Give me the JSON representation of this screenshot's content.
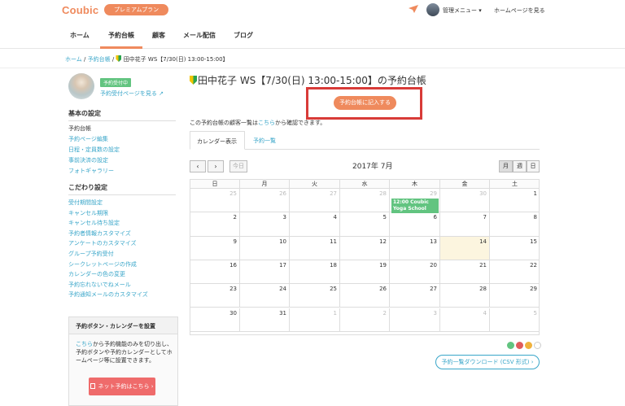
{
  "header": {
    "logo": "Coubic",
    "plan_badge": "プレミアムプラン",
    "admin_menu": "管理メニュー ▾",
    "home_link": "ホームページを見る"
  },
  "nav": {
    "items": [
      "ホーム",
      "予約台帳",
      "顧客",
      "メール配信",
      "ブログ"
    ],
    "active": "予約台帳"
  },
  "breadcrumb": {
    "home": "ホーム",
    "sep": "/",
    "ledger": "予約台帳",
    "current": "田中花子 WS【7/30(日) 13:00-15:00】"
  },
  "sidebar": {
    "status_badge": "予約受付中",
    "reservation_page_link": "予約受付ページを見る ↗",
    "basic_heading": "基本の設定",
    "basic_items": [
      "予約台帳",
      "予約ページ編集",
      "日程・定員数の設定",
      "事前決済の設定",
      "フォトギャラリー"
    ],
    "advanced_heading": "こだわり設定",
    "advanced_items": [
      "受付期間設定",
      "キャンセル期限",
      "キャンセル待ち設定",
      "予約者情報カスタマイズ",
      "アンケートのカスタマイズ",
      "グループ予約受付",
      "シークレットページの作成",
      "カレンダーの色の変更",
      "予約忘れないでねメール",
      "予約通知メールのカスタマイズ"
    ],
    "box_heading": "予約ボタン・カレンダーを設置",
    "box_text_link": "こちら",
    "box_text": "から予約機能のみを切り出し、予約ボタンや予約カレンダーとしてホームページ等に設置できます。",
    "net_button": "ネット予約はこちら ›"
  },
  "main": {
    "title": "田中花子 WS【7/30(日) 13:00-15:00】の予約台帳",
    "fill_button": "予約台帳に記入する",
    "info_prefix": "この予約台帳の顧客一覧は",
    "info_link": "こちら",
    "info_suffix": "から確認できます。",
    "tabs": [
      "カレンダー表示",
      "予約一覧"
    ],
    "prev": "‹",
    "next": "›",
    "today": "今日",
    "month": "2017年 7月",
    "views": [
      "月",
      "週",
      "日"
    ],
    "download_button": "予約一覧ダウンロード (CSV 形式) ›"
  },
  "calendar": {
    "weekdays": [
      "日",
      "月",
      "火",
      "水",
      "木",
      "金",
      "土"
    ],
    "weeks": [
      [
        {
          "d": "25",
          "o": true
        },
        {
          "d": "26",
          "o": true
        },
        {
          "d": "27",
          "o": true
        },
        {
          "d": "28",
          "o": true
        },
        {
          "d": "29",
          "o": true
        },
        {
          "d": "30",
          "o": true
        },
        {
          "d": "1",
          "o": false
        }
      ],
      [
        {
          "d": "2",
          "o": false
        },
        {
          "d": "3",
          "o": false
        },
        {
          "d": "4",
          "o": false
        },
        {
          "d": "5",
          "o": false
        },
        {
          "d": "6",
          "o": false
        },
        {
          "d": "7",
          "o": false
        },
        {
          "d": "8",
          "o": false
        }
      ],
      [
        {
          "d": "9",
          "o": false
        },
        {
          "d": "10",
          "o": false
        },
        {
          "d": "11",
          "o": false
        },
        {
          "d": "12",
          "o": false
        },
        {
          "d": "13",
          "o": false
        },
        {
          "d": "14",
          "o": false
        },
        {
          "d": "15",
          "o": false
        }
      ],
      [
        {
          "d": "16",
          "o": false
        },
        {
          "d": "17",
          "o": false
        },
        {
          "d": "18",
          "o": false
        },
        {
          "d": "19",
          "o": false
        },
        {
          "d": "20",
          "o": false
        },
        {
          "d": "21",
          "o": false
        },
        {
          "d": "22",
          "o": false
        }
      ],
      [
        {
          "d": "23",
          "o": false
        },
        {
          "d": "24",
          "o": false
        },
        {
          "d": "25",
          "o": false
        },
        {
          "d": "26",
          "o": false
        },
        {
          "d": "27",
          "o": false
        },
        {
          "d": "28",
          "o": false
        },
        {
          "d": "29",
          "o": false
        }
      ],
      [
        {
          "d": "30",
          "o": false
        },
        {
          "d": "31",
          "o": false
        },
        {
          "d": "1",
          "o": true
        },
        {
          "d": "2",
          "o": true
        },
        {
          "d": "3",
          "o": true
        },
        {
          "d": "4",
          "o": true
        },
        {
          "d": "5",
          "o": true
        }
      ]
    ],
    "today": "14",
    "event": {
      "time": "12:00",
      "name": "Coubic Yoga School",
      "date": "29"
    },
    "color_dots": [
      "#62c480",
      "#e05c5c",
      "#f0b23c",
      "#ffffff"
    ]
  },
  "colors": {
    "accent": "#ef8a5d",
    "link": "#39a6c9",
    "green": "#62c480",
    "highlight": "#d83b38"
  }
}
